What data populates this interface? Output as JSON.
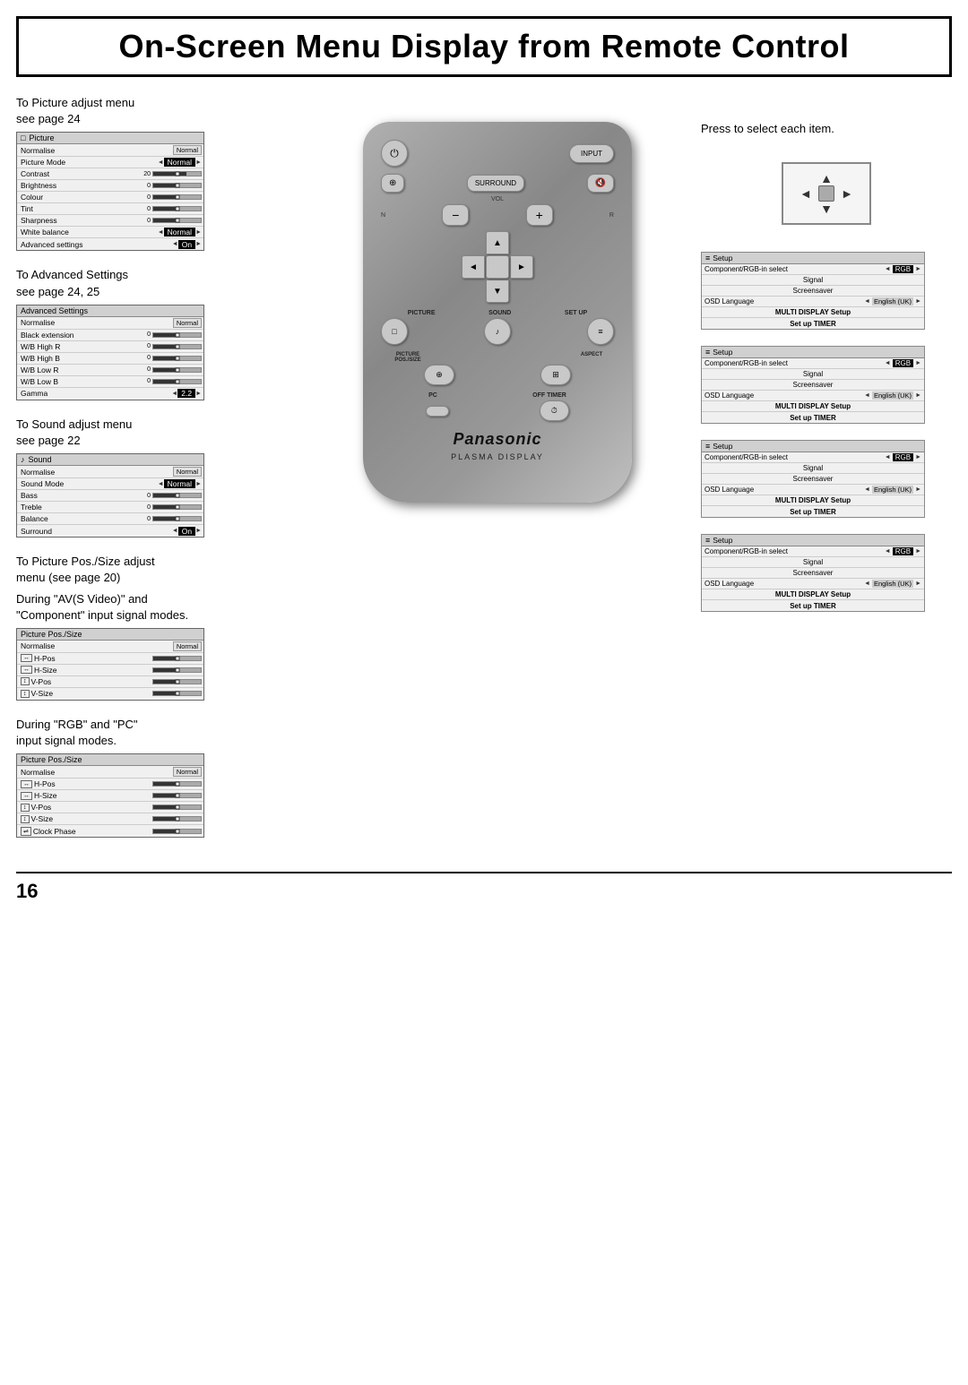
{
  "header": {
    "title": "On-Screen Menu Display from Remote Control"
  },
  "page_number": "16",
  "left_sections": [
    {
      "id": "picture-adjust",
      "label": "To Picture adjust menu\nsee page 24",
      "menu_title": "Picture",
      "menu_icon": "picture",
      "rows": [
        {
          "label": "Normalise",
          "type": "normalise",
          "value": "Normal"
        },
        {
          "label": "Picture Mode",
          "type": "arrow-highlight",
          "value": "Normal"
        },
        {
          "label": "Contrast",
          "type": "bar",
          "value": "20"
        },
        {
          "label": "Brightness",
          "type": "bar",
          "value": "0"
        },
        {
          "label": "Colour",
          "type": "bar",
          "value": "0"
        },
        {
          "label": "Tint",
          "type": "bar",
          "value": "0"
        },
        {
          "label": "Sharpness",
          "type": "bar",
          "value": "0"
        },
        {
          "label": "White balance",
          "type": "arrow-highlight",
          "value": "Normal"
        },
        {
          "label": "Advanced settings",
          "type": "arrow-highlight",
          "value": "On"
        }
      ]
    },
    {
      "id": "advanced-settings",
      "label": "To Advanced Settings\nsee page 24, 25",
      "menu_title": "Advanced Settings",
      "menu_icon": "none",
      "rows": [
        {
          "label": "Normalise",
          "type": "normalise",
          "value": "Normal"
        },
        {
          "label": "Black extension",
          "type": "bar",
          "value": "0"
        },
        {
          "label": "W/B High R",
          "type": "bar",
          "value": "0"
        },
        {
          "label": "W/B High B",
          "type": "bar",
          "value": "0"
        },
        {
          "label": "W/B Low R",
          "type": "bar",
          "value": "0"
        },
        {
          "label": "W/B Low B",
          "type": "bar",
          "value": "0"
        },
        {
          "label": "Gamma",
          "type": "arrow-highlight",
          "value": "2.2"
        }
      ]
    },
    {
      "id": "sound-adjust",
      "label": "To Sound adjust menu\nsee page 22",
      "menu_title": "Sound",
      "menu_icon": "sound",
      "rows": [
        {
          "label": "Normalise",
          "type": "normalise",
          "value": "Normal"
        },
        {
          "label": "Sound Mode",
          "type": "arrow-highlight",
          "value": "Normal"
        },
        {
          "label": "Bass",
          "type": "bar",
          "value": "0"
        },
        {
          "label": "Treble",
          "type": "bar",
          "value": "0"
        },
        {
          "label": "Balance",
          "type": "bar",
          "value": "0"
        },
        {
          "label": "Surround",
          "type": "arrow-highlight",
          "value": "On"
        }
      ]
    },
    {
      "id": "picture-pos-av",
      "label": "To Picture Pos./Size adjust\nmenu (see page 20)",
      "sublabel": "During \"AV(S Video)\" and\n\"Component\" input signal modes.",
      "menu_title": "Picture Pos./Size",
      "rows": [
        {
          "label": "Normalise",
          "type": "normalise",
          "value": "Normal"
        },
        {
          "label": "H-Pos",
          "type": "bar-icon",
          "icon": "H"
        },
        {
          "label": "H-Size",
          "type": "bar-icon",
          "icon": "H"
        },
        {
          "label": "V-Pos",
          "type": "bar-icon",
          "icon": "V"
        },
        {
          "label": "V-Size",
          "type": "bar-icon",
          "icon": "V"
        }
      ]
    },
    {
      "id": "picture-pos-rgb",
      "label": "During \"RGB\" and \"PC\"\ninput signal modes.",
      "menu_title": "Picture Pos./Size",
      "rows": [
        {
          "label": "Normalise",
          "type": "normalise",
          "value": "Normal"
        },
        {
          "label": "H-Pos",
          "type": "bar-icon",
          "icon": "H"
        },
        {
          "label": "H-Size",
          "type": "bar-icon",
          "icon": "H"
        },
        {
          "label": "V-Pos",
          "type": "bar-icon",
          "icon": "V"
        },
        {
          "label": "V-Size",
          "type": "bar-icon",
          "icon": "V"
        },
        {
          "label": "Clock Phase",
          "type": "bar-icon",
          "icon": "C"
        }
      ]
    }
  ],
  "right_top_label": "Press to select each item.",
  "right_sections": [
    {
      "id": "setup-1",
      "menu_title": "Setup",
      "rows": [
        {
          "label": "Component/RGB-in select",
          "type": "arrow-highlight",
          "value": "RGB"
        },
        {
          "label": "Signal",
          "type": "center"
        },
        {
          "label": "Screensaver",
          "type": "center"
        },
        {
          "label": "OSD Language",
          "type": "arrow-highlight",
          "value": "English (UK)"
        },
        {
          "label": "MULTI DISPLAY Setup",
          "type": "bold-center"
        },
        {
          "label": "Set up TIMER",
          "type": "bold-center"
        }
      ]
    },
    {
      "id": "setup-2",
      "menu_title": "Setup",
      "rows": [
        {
          "label": "Component/RGB-in select",
          "type": "arrow-highlight",
          "value": "RGB"
        },
        {
          "label": "Signal",
          "type": "center"
        },
        {
          "label": "Screensaver",
          "type": "center"
        },
        {
          "label": "OSD Language",
          "type": "arrow-highlight",
          "value": "English (UK)"
        },
        {
          "label": "MULTI DISPLAY Setup",
          "type": "bold-center"
        },
        {
          "label": "Set up TIMER",
          "type": "bold-center"
        }
      ]
    },
    {
      "id": "setup-3",
      "menu_title": "Setup",
      "rows": [
        {
          "label": "Component/RGB-in select",
          "type": "arrow-highlight",
          "value": "RGB"
        },
        {
          "label": "Signal",
          "type": "center"
        },
        {
          "label": "Screensaver",
          "type": "center"
        },
        {
          "label": "OSD Language",
          "type": "arrow-highlight",
          "value": "English (UK)"
        },
        {
          "label": "MULTI DISPLAY Setup",
          "type": "bold-center"
        },
        {
          "label": "Set up TIMER",
          "type": "bold-center"
        }
      ]
    },
    {
      "id": "setup-4",
      "menu_title": "Setup",
      "rows": [
        {
          "label": "Component/RGB-in select",
          "type": "arrow-highlight",
          "value": "RGB"
        },
        {
          "label": "Signal",
          "type": "center"
        },
        {
          "label": "Screensaver",
          "type": "center"
        },
        {
          "label": "OSD Language",
          "type": "arrow-highlight",
          "value": "English (UK)"
        },
        {
          "label": "MULTI DISPLAY Setup",
          "type": "bold-center"
        },
        {
          "label": "Set up TIMER",
          "type": "bold-center"
        }
      ]
    }
  ],
  "remote": {
    "brand": "Panasonic",
    "model": "PLASMA DISPLAY",
    "buttons": {
      "power": "⏻",
      "input": "INPUT",
      "surround": "SURROUND",
      "vol_label": "VOL",
      "vol_minus": "−",
      "vol_plus": "+",
      "picture_label": "PICTURE",
      "sound_label": "SOUND",
      "setup_label": "SET UP",
      "picture_pos_label": "PICTURE\nPOS./SIZE",
      "aspect_label": "ASPECT",
      "pc_label": "PC",
      "off_timer_label": "OFF TIMER",
      "n_label": "N",
      "r_label": "R"
    }
  }
}
